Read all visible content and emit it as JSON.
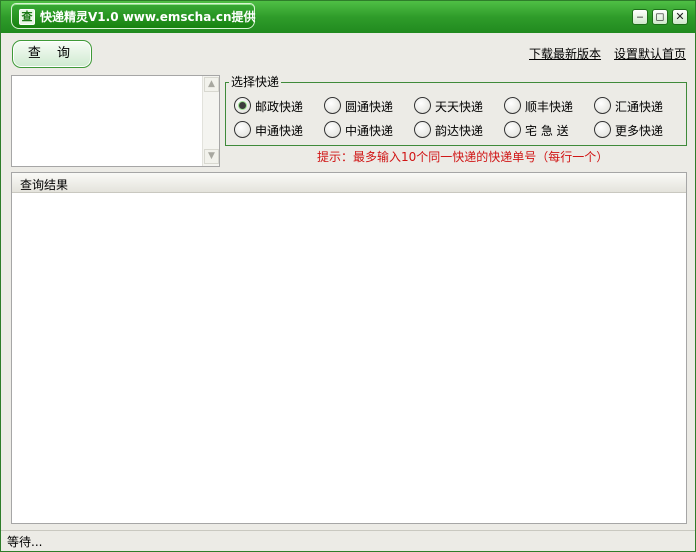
{
  "window": {
    "title": "快递精灵V1.0 www.emscha.cn提供",
    "icon_glyph": "查"
  },
  "toolbar": {
    "query_label": "查 询",
    "links": [
      {
        "label": "下载最新版本"
      },
      {
        "label": "设置默认首页"
      }
    ]
  },
  "input": {
    "value": ""
  },
  "carrier_group": {
    "legend": "选择快递",
    "options": [
      {
        "label": "邮政快递",
        "checked": true
      },
      {
        "label": "圆通快递",
        "checked": false
      },
      {
        "label": "天天快递",
        "checked": false
      },
      {
        "label": "顺丰快递",
        "checked": false
      },
      {
        "label": "汇通快递",
        "checked": false
      },
      {
        "label": "申通快递",
        "checked": false
      },
      {
        "label": "中通快递",
        "checked": false
      },
      {
        "label": "韵达快递",
        "checked": false
      },
      {
        "label": "宅 急 送",
        "checked": false
      },
      {
        "label": "更多快递",
        "checked": false
      }
    ]
  },
  "hint": "提示：最多输入10个同一快递的快递单号（每行一个）",
  "results": {
    "header": "查询结果"
  },
  "status": "等待...",
  "colors": {
    "title_green": "#2f9c2a",
    "hint_red": "#d01414",
    "frame_bg": "#ecebe6"
  }
}
